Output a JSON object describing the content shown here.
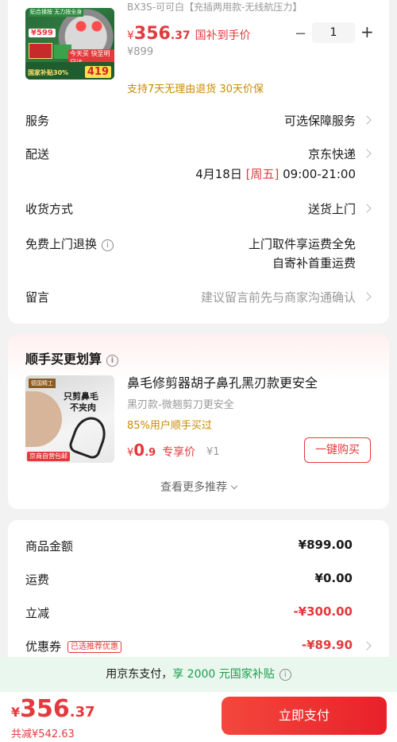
{
  "product": {
    "thumb": {
      "top_tag": "贴合揉按 无力按全身",
      "price_tag": "¥599",
      "mid_tag": "今天买 快至明日达",
      "bottom_text": "国家补贴30%",
      "bottom_price": "419"
    },
    "variant": "BX3S-可可白【充插两用款-无线航压力】",
    "price": {
      "currency": "¥",
      "integer": "356",
      "decimal": ".37"
    },
    "price_note": "国补到手价",
    "original_price": "¥899",
    "quantity": "1",
    "minus": "−",
    "plus": "+",
    "guarantee": "支持7天无理由退货  30天价保"
  },
  "rows": {
    "service_label": "服务",
    "service_value": "可选保障服务",
    "delivery_label": "配送",
    "delivery_value": "京东快递",
    "delivery_date": "4月18日",
    "delivery_weekday": "[周五]",
    "delivery_time": "09:00-21:00",
    "receive_label": "收货方式",
    "receive_value": "送货上门",
    "return_label": "免费上门退换",
    "return_value_1": "上门取件享运费全免",
    "return_value_2": "自寄补首重运费",
    "message_label": "留言",
    "message_placeholder": "建议留言前先与商家沟通确认"
  },
  "reco": {
    "title": "顺手买更划算",
    "thumb": {
      "badge": "德国精工",
      "line1": "只剪鼻毛",
      "line2": "不夹肉",
      "red_tag": "京商自营包邮"
    },
    "name": "鼻毛修剪器胡子鼻孔黑刃款更安全",
    "sub": "黑刃款-微翘剪刀更安全",
    "bought": "85%用户顺手买过",
    "price": {
      "currency": "¥",
      "integer": "0",
      "decimal": ".9"
    },
    "price_label": "专享价",
    "original_price": "¥1",
    "buy_label": "一键购买",
    "more_label": "查看更多推荐"
  },
  "summary": {
    "goods_label": "商品金额",
    "goods_value": "¥899.00",
    "shipping_label": "运费",
    "shipping_value": "¥0.00",
    "discount_label": "立减",
    "discount_value": "-¥300.00",
    "coupon_label": "优惠券",
    "coupon_tag": "已选推荐优惠",
    "coupon_value": "-¥89.90"
  },
  "banner": {
    "text_prefix": "用京东支付，",
    "text_highlight": "享 2000 元国家补贴"
  },
  "bottom": {
    "total": {
      "currency": "¥",
      "integer": "356",
      "decimal": ".37"
    },
    "total_discount": "共减¥542.63",
    "pay_label": "立即支付"
  },
  "colors": {
    "accent_red": "#e4393c",
    "gold": "#c88b00",
    "banner_green": "#1a9e4b"
  }
}
